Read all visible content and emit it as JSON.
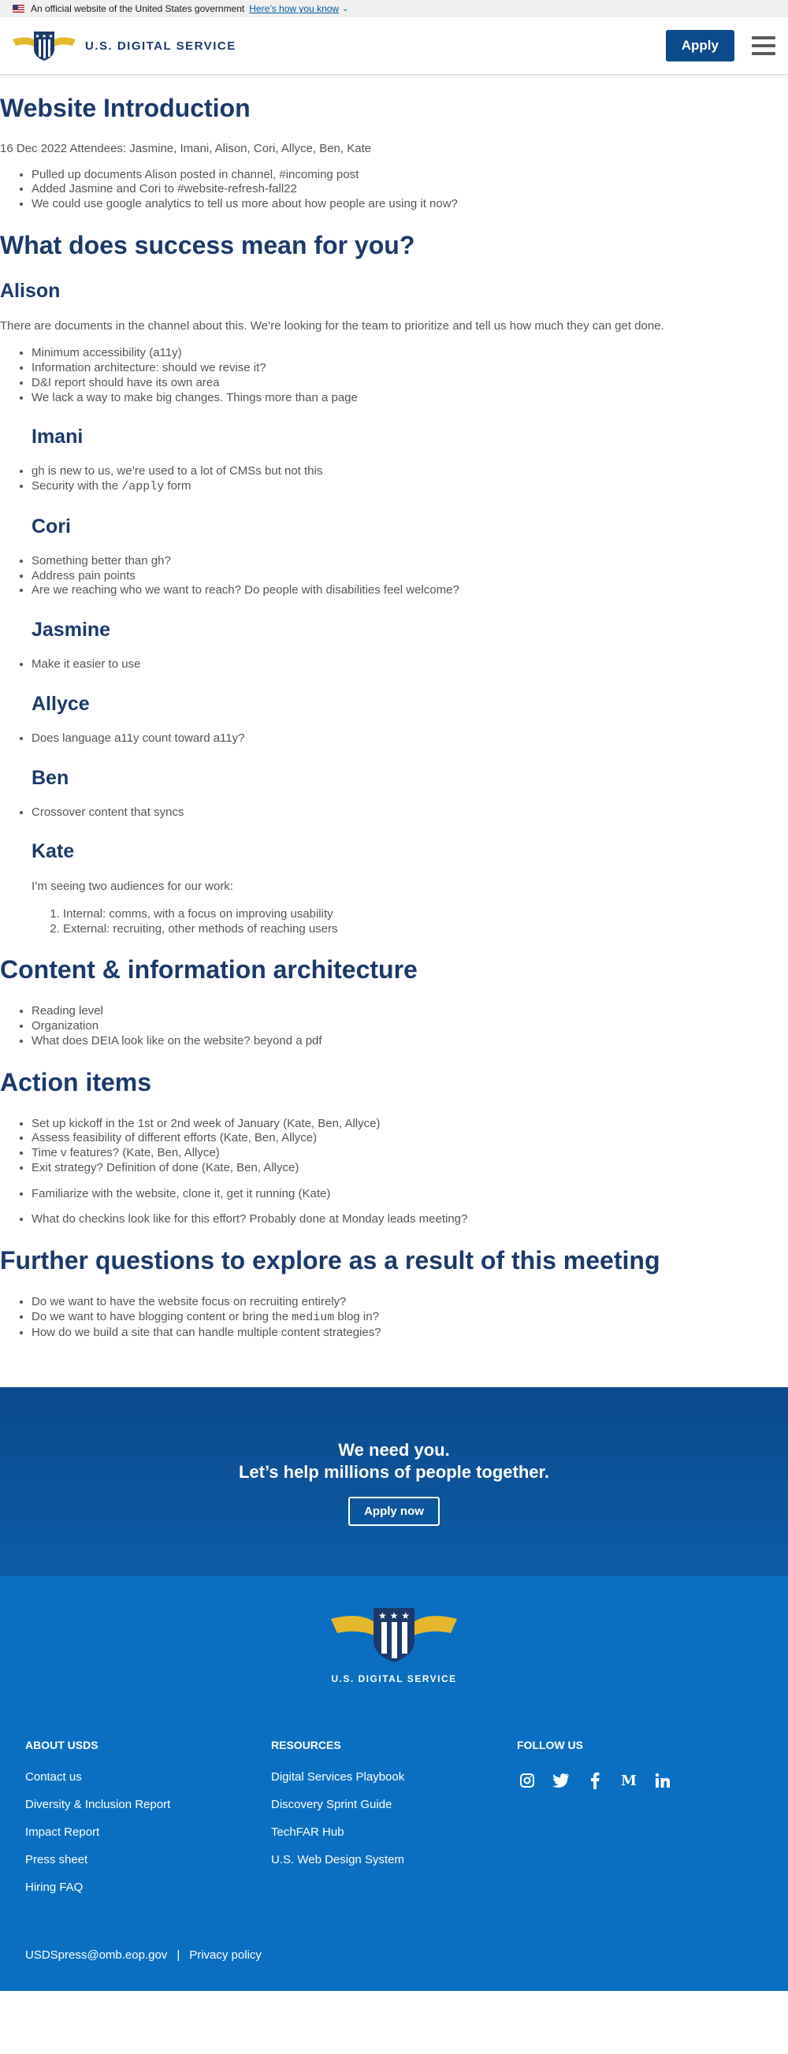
{
  "banner": {
    "official_text": "An official website of the United States government",
    "howto_link": "Here’s how you know"
  },
  "header": {
    "logo_text": "U.S. DIGITAL SERVICE",
    "apply_label": "Apply"
  },
  "main": {
    "title": "Website Introduction",
    "meta": "16 Dec 2022 Attendees: Jasmine, Imani, Alison, Cori, Allyce, Ben, Kate",
    "intro_items": [
      "Pulled up documents Alison posted in channel, #incoming post",
      "Added Jasmine and Cori to #website-refresh-fall22",
      "We could use google analytics to tell us more about how people are using it now?"
    ],
    "success_heading": "What does success mean for you?",
    "alison": {
      "name": "Alison",
      "text": "There are documents in the channel about this. We’re looking for the team to prioritize and tell us how much they can get done.",
      "items": [
        "Minimum accessibility (a11y)",
        "Information architecture: should we revise it?",
        "D&I report should have its own area",
        "We lack a way to make big changes. Things more than a page"
      ]
    },
    "imani": {
      "name": "Imani",
      "item1": "gh is new to us, we’re used to a lot of CMSs but not this",
      "item2_pre": "Security with the ",
      "item2_code": "/apply",
      "item2_post": " form"
    },
    "cori": {
      "name": "Cori",
      "items": [
        "Something better than gh?",
        "Address pain points",
        "Are we reaching who we want to reach? Do people with disabilities feel welcome?"
      ]
    },
    "jasmine": {
      "name": "Jasmine",
      "items": [
        "Make it easier to use"
      ]
    },
    "allyce": {
      "name": "Allyce",
      "items": [
        "Does language a11y count toward a11y?"
      ]
    },
    "ben": {
      "name": "Ben",
      "items": [
        "Crossover content that syncs"
      ]
    },
    "kate": {
      "name": "Kate",
      "text": "I’m seeing two audiences for our work:",
      "items": [
        "Internal: comms, with a focus on improving usability",
        "External: recruiting, other methods of reaching users"
      ]
    },
    "content_heading": "Content & information architecture",
    "content_items": [
      "Reading level",
      "Organization",
      "What does DEIA look like on the website? beyond a pdf"
    ],
    "actions_heading": "Action items",
    "action_items": [
      "Set up kickoff in the 1st or 2nd week of January (Kate, Ben, Allyce)",
      "Assess feasibility of different efforts (Kate, Ben, Allyce)",
      "Time v features? (Kate, Ben, Allyce)",
      "Exit strategy? Definition of done (Kate, Ben, Allyce)"
    ],
    "action_item_2": "Familiarize with the website, clone it, get it running (Kate)",
    "action_item_3": "What do checkins look like for this effort? Probably done at Monday leads meeting?",
    "further_heading": "Further questions to explore as a result of this meeting",
    "further_item1": "Do we want to have the website focus on recruiting entirely?",
    "further_item2_pre": "Do we want to have blogging content or bring the ",
    "further_item2_code": "medium",
    "further_item2_post": " blog in?",
    "further_item3": "How do we build a site that can handle multiple content strategies?"
  },
  "cta": {
    "line1": "We need you.",
    "line2": "Let’s help millions of people together.",
    "button": "Apply now"
  },
  "footer": {
    "logo_text": "U.S. DIGITAL SERVICE",
    "about_heading": "ABOUT USDS",
    "about_links": [
      "Contact us",
      "Diversity & Inclusion Report",
      "Impact Report",
      "Press sheet",
      "Hiring FAQ"
    ],
    "resources_heading": "RESOURCES",
    "resources_links": [
      "Digital Services Playbook",
      "Discovery Sprint Guide",
      "TechFAR Hub",
      "U.S. Web Design System"
    ],
    "follow_heading": "FOLLOW US",
    "social_icons": [
      "instagram-icon",
      "twitter-icon",
      "facebook-icon",
      "medium-icon",
      "linkedin-icon"
    ],
    "email": "USDSpress@omb.eop.gov",
    "separator": "|",
    "privacy": "Privacy policy"
  },
  "colors": {
    "brand_navy": "#1b3a6b",
    "button_blue": "#0b4a8b",
    "footer_blue": "#0b6fc1",
    "gold": "#e5b82b"
  }
}
